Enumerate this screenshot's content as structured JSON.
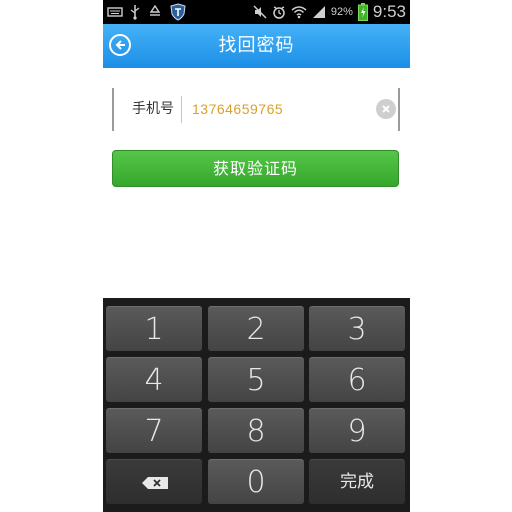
{
  "status_bar": {
    "battery_percent": "92%",
    "time": "9:53"
  },
  "header": {
    "title": "找回密码"
  },
  "form": {
    "phone_label": "手机号",
    "phone_value": "13764659765",
    "get_code_label": "获取验证码"
  },
  "keypad": {
    "keys": [
      {
        "label": "1"
      },
      {
        "label": "2"
      },
      {
        "label": "3"
      },
      {
        "label": "4"
      },
      {
        "label": "5"
      },
      {
        "label": "6"
      },
      {
        "label": "7"
      },
      {
        "label": "8"
      },
      {
        "label": "9"
      },
      {
        "icon": "backspace-icon"
      },
      {
        "label": "0"
      },
      {
        "label": "完成"
      }
    ]
  },
  "colors": {
    "header_blue": "#2b9ff0",
    "button_green": "#45b83a",
    "phone_text": "#d9a12b",
    "keypad_bg": "#1b1b1b"
  }
}
